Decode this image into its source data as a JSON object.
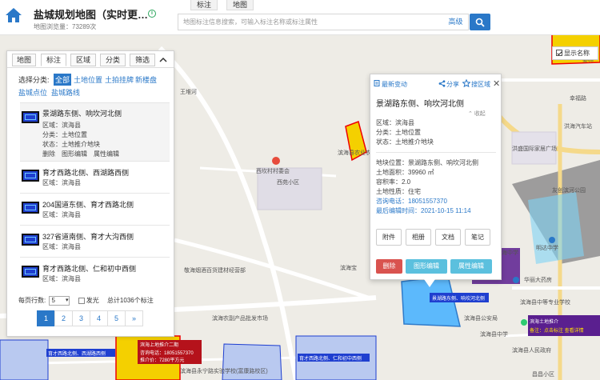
{
  "header": {
    "title": "盐城规划地图（实时更…",
    "view_count": "地图浏览量：73289次",
    "search_placeholder": "地图标注信息搜索，可输入标注名称或标注属性",
    "advanced_label": "高级",
    "top_tabs": [
      "标注",
      "地图"
    ]
  },
  "controls": {
    "show_name_label": "显示名称"
  },
  "map": {
    "labels": [
      "王堆河",
      "西坎村村委会",
      "西苑小区",
      "滨海县农业农村局",
      "滨海宝",
      "敬海烟酒百货建材经营部",
      "滨海农副产品批发市场",
      "滨海中学",
      "华丽大药房",
      "滨海县中等专业学校",
      "滨海县永宁路实验学校(富康路校区)",
      "滨海县公安局",
      "洪海汽车站",
      "洪盛国际家居广场",
      "友创滨河公园",
      "明达中学",
      "晏林",
      "幸福路",
      "滨海县人民政府",
      "滨海县中学",
      "昌昌小区"
    ],
    "markers": [
      "景湖路东侧、响坎河北侧",
      "育才西路北侧、西湖路西侧",
      "育才西路北侧、仁和初中西侧",
      "滨海土地推介",
      "备注：点击标注 查看详情"
    ],
    "red_marker": [
      "滨海上地推介二期",
      "咨询电话：18051557370",
      "推介价：7280平方元"
    ]
  },
  "left_panel": {
    "tabs": [
      "地图",
      "标注",
      "区域",
      "分类",
      "筛选"
    ],
    "category_label": "选择分类:",
    "category_links": [
      "全部",
      "土地位置",
      "土拍挂牌",
      "新楼盘",
      "盐城点位",
      "盐城路线"
    ],
    "items": [
      {
        "title": "景湖路东侧、响坎河北侧",
        "region": "区域：滨海县",
        "category": "分类：土地位置",
        "status": "状态：土地推介地块",
        "actions": "删除　图形编辑　属性编辑"
      },
      {
        "title": "育才西路北侧、西湖路西侧",
        "region": "区域：滨海县"
      },
      {
        "title": "204国道东侧、育才西路北侧",
        "region": "区域：滨海县"
      },
      {
        "title": "327省道南侧、育才大沟西侧",
        "region": "区域：滨海县"
      },
      {
        "title": "育才西路北侧、仁和初中西侧",
        "region": "区域：滨海县"
      }
    ],
    "pager": {
      "per_page_label": "每页行数:",
      "per_page_value": "5",
      "glow_label": "发光",
      "total_label": "总计1036个标注",
      "pages": [
        "1",
        "2",
        "3",
        "4",
        "5",
        "»"
      ]
    }
  },
  "popup": {
    "recent_label": "最新变动",
    "share_label": "分享",
    "search_area_label": "搜区域",
    "title": "景湖路东侧、响坎河北侧",
    "collapse_label": "收起",
    "region": "区域：滨海县",
    "category": "分类：土地位置",
    "status": "状态：土地推介地块",
    "location": "地块位置：景湖路东侧、响坎河北侧",
    "area": "土地面积：39960 ㎡",
    "ratio": "容积率：2.0",
    "nature": "土地性质：住宅",
    "phone": "咨询电话：18051557370",
    "last_edit": "最后编辑时间：2021-10-15 11:14",
    "buttons": [
      "附件",
      "相册",
      "文档",
      "笔记"
    ],
    "actions": [
      "删除",
      "图形编辑",
      "属性编辑"
    ]
  },
  "colors": {
    "accent": "#2a78c8",
    "danger": "#d9534f",
    "teal": "#5bc0de"
  }
}
